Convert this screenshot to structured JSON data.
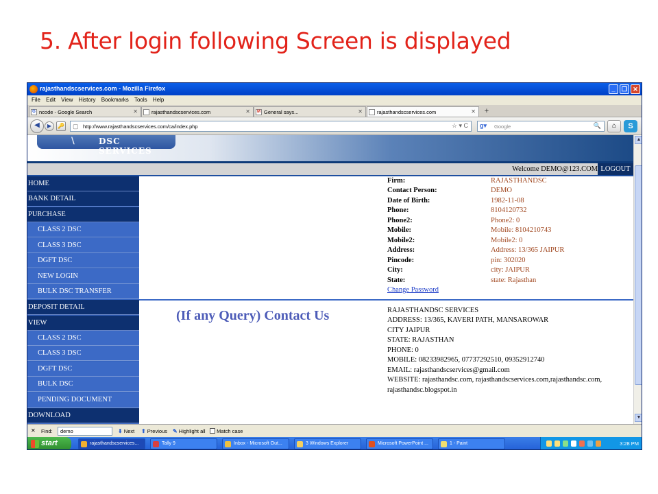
{
  "slide": {
    "title": "5. After login following Screen is displayed"
  },
  "browser": {
    "window_title": "rajasthandscservices.com - Mozilla Firefox",
    "menu": [
      "File",
      "Edit",
      "View",
      "History",
      "Bookmarks",
      "Tools",
      "Help"
    ],
    "tabs": [
      {
        "label": "ncode - Google Search",
        "icon": "G"
      },
      {
        "label": "rajasthandscservices.com",
        "icon": ""
      },
      {
        "label": "General says...",
        "icon": "M"
      },
      {
        "label": "rajasthandscservices.com",
        "icon": ""
      }
    ],
    "url": "http://www.rajasthandscservices.com/ca/index.php",
    "search_placeholder": "Google"
  },
  "site": {
    "logo_text": "DSC SERVICES",
    "welcome": "Welcome DEMO@123.COM",
    "logout": "LOGOUT",
    "menu": [
      {
        "label": "HOME",
        "type": "head"
      },
      {
        "label": "BANK DETAIL",
        "type": "head"
      },
      {
        "label": "PURCHASE",
        "type": "head"
      },
      {
        "label": "CLASS 2 DSC",
        "type": "sub"
      },
      {
        "label": "CLASS 3 DSC",
        "type": "sub"
      },
      {
        "label": "DGFT DSC",
        "type": "sub"
      },
      {
        "label": "NEW LOGIN",
        "type": "sub"
      },
      {
        "label": "BULK DSC TRANSFER",
        "type": "sub"
      },
      {
        "label": "DEPOSIT DETAIL",
        "type": "head"
      },
      {
        "label": "VIEW",
        "type": "head"
      },
      {
        "label": "CLASS 2 DSC",
        "type": "sub"
      },
      {
        "label": "CLASS 3 DSC",
        "type": "sub"
      },
      {
        "label": "DGFT DSC",
        "type": "sub"
      },
      {
        "label": "BULK DSC",
        "type": "sub"
      },
      {
        "label": "PENDING DOCUMENT",
        "type": "sub"
      },
      {
        "label": "DOWNLOAD",
        "type": "head"
      }
    ],
    "profile": [
      {
        "label": "Firm:",
        "value": "RAJASTHANDSC"
      },
      {
        "label": "Contact Person:",
        "value": "DEMO"
      },
      {
        "label": "Date of Birth:",
        "value": "1982-11-08"
      },
      {
        "label": "Phone:",
        "value": "8104120732"
      },
      {
        "label": "Phone2:",
        "value": "Phone2: 0"
      },
      {
        "label": "Mobile:",
        "value": "Mobile: 8104210743"
      },
      {
        "label": "Mobile2:",
        "value": "Mobile2: 0"
      },
      {
        "label": "Address:",
        "value": "Address: 13/365 JAIPUR"
      },
      {
        "label": "Pincode:",
        "value": "pin: 302020"
      },
      {
        "label": "City:",
        "value": "city: JAIPUR"
      },
      {
        "label": "State:",
        "value": "state: Rajasthan"
      }
    ],
    "change_password": "Change Password",
    "query_heading": "(If any Query) Contact Us",
    "contact": [
      "RAJASTHANDSC SERVICES",
      "ADDRESS: 13/365, KAVERI PATH, MANSAROWAR",
      "CITY JAIPUR",
      "STATE: RAJASTHAN",
      "PHONE: 0",
      "MOBILE: 08233982965, 07737292510, 09352912740",
      "EMAIL: rajasthandscservices@gmail.com",
      "WEBSITE: rajasthandsc.com, rajasthandscservices.com,rajasthandsc.com,",
      "rajasthandsc.blogspot.in"
    ]
  },
  "findbar": {
    "label": "Find:",
    "value": "demo",
    "next": "Next",
    "previous": "Previous",
    "highlight": "Highlight all",
    "match_case": "Match case"
  },
  "taskbar": {
    "start": "start",
    "tasks": [
      "rajasthandscservices...",
      "Tally 9",
      "Inbox - Microsoft Out...",
      "3 Windows Explorer",
      "Microsoft PowerPoint ...",
      "1 - Paint"
    ],
    "clock": "3:28 PM"
  }
}
